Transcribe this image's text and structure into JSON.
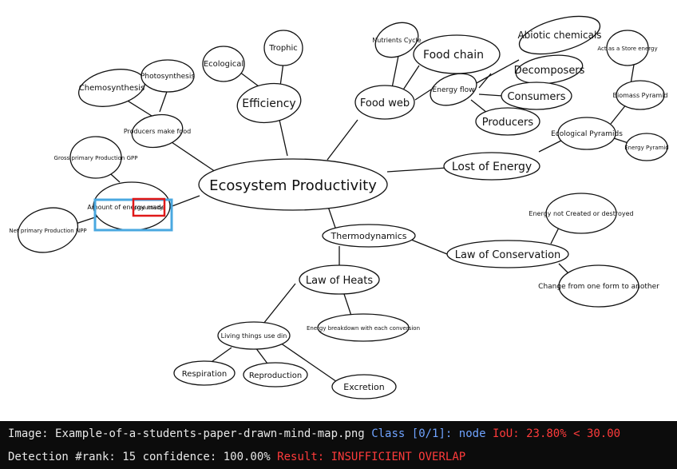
{
  "mindmap": {
    "central": "Ecosystem Productivity",
    "nodes": {
      "chemosynthesis": "Chemosynthesis",
      "photosynthesis": "Photosynthesis",
      "producers_make_food": "Producers make food",
      "gross_primary": "Gross primary Production GPP",
      "amount_energy": "Amount of energy made",
      "net_primary": "Net primary Production NPP",
      "ecological": "Ecological",
      "trophic": "Trophic",
      "efficiency": "Efficiency",
      "nutrients_cycle": "Nutrients Cycle",
      "food_chain": "Food chain",
      "food_web": "Food web",
      "energy_flow": "Energy flow",
      "abiotic": "Abiotic chemicals",
      "decomposers": "Decomposers",
      "consumers": "Consumers",
      "producers": "Producers",
      "act_as_store": "Act as a Store energy",
      "biomass_pyramid": "Biomass Pyramid",
      "ecological_pyramids": "Ecological Pyramids",
      "energy_pyramid": "Energy Pyramid",
      "lost_of_energy": "Lost of Energy",
      "thermodynamics": "Thermodynamics",
      "law_of_conservation": "Law of Conservation",
      "energy_not_created": "Energy not Created or destroyed",
      "change_from": "Change from one form to another",
      "law_of_heats": "Law of Heats",
      "energy_breakdown": "Energy breakdown with each conversion",
      "living_things": "Living things use din",
      "respiration": "Respiration",
      "reproduction": "Reproduction",
      "excretion": "Excretion"
    },
    "ground_truth_box_label": "productivity"
  },
  "colors": {
    "detection_box": "#4aa8e0",
    "ground_truth_box": "#e01818",
    "class_text": "#6fa3ff",
    "fail_text": "#ff3b3b"
  },
  "status": {
    "image_label": "Image:",
    "image_name": "Example-of-a-students-paper-drawn-mind-map.png",
    "class_text": "Class [0/1]:",
    "class_name": "node",
    "iou_text": "IoU: 23.80% < 30.00",
    "detection_text": "Detection #rank: 15 confidence: 100.00%",
    "result_text": "Result: INSUFFICIENT OVERLAP"
  }
}
